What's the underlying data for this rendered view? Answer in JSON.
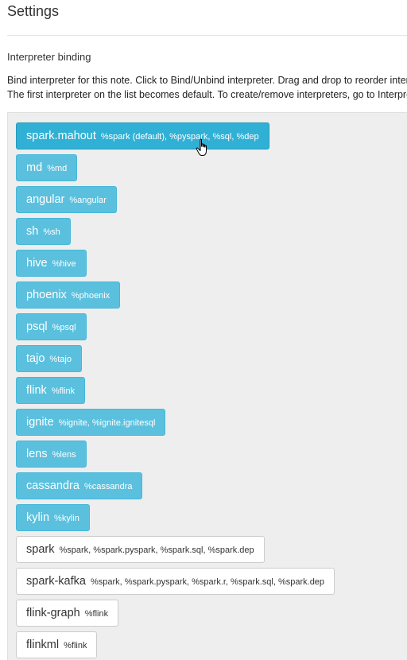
{
  "header": {
    "title": "Settings"
  },
  "interpreter_binding": {
    "heading": "Interpreter binding",
    "description_line1": "Bind interpreter for this note. Click to Bind/Unbind interpreter. Drag and drop to reorder interpreters.",
    "description_line2": "The first interpreter on the list becomes default. To create/remove interpreters, go to Interpreter menu.",
    "interpreters": [
      {
        "name": "spark.mahout",
        "aliases": "%spark (default), %pyspark, %sql, %dep",
        "selected": true,
        "hover": true
      },
      {
        "name": "md",
        "aliases": "%md",
        "selected": true
      },
      {
        "name": "angular",
        "aliases": "%angular",
        "selected": true
      },
      {
        "name": "sh",
        "aliases": "%sh",
        "selected": true
      },
      {
        "name": "hive",
        "aliases": "%hive",
        "selected": true
      },
      {
        "name": "phoenix",
        "aliases": "%phoenix",
        "selected": true
      },
      {
        "name": "psql",
        "aliases": "%psql",
        "selected": true
      },
      {
        "name": "tajo",
        "aliases": "%tajo",
        "selected": true
      },
      {
        "name": "flink",
        "aliases": "%flink",
        "selected": true
      },
      {
        "name": "ignite",
        "aliases": "%ignite, %ignite.ignitesql",
        "selected": true
      },
      {
        "name": "lens",
        "aliases": "%lens",
        "selected": true
      },
      {
        "name": "cassandra",
        "aliases": "%cassandra",
        "selected": true
      },
      {
        "name": "kylin",
        "aliases": "%kylin",
        "selected": true
      },
      {
        "name": "spark",
        "aliases": "%spark, %spark.pyspark, %spark.sql, %spark.dep",
        "selected": false
      },
      {
        "name": "spark-kafka",
        "aliases": "%spark, %spark.pyspark, %spark.r, %spark.sql, %spark.dep",
        "selected": false
      },
      {
        "name": "flink-graph",
        "aliases": "%flink",
        "selected": false
      },
      {
        "name": "flinkml",
        "aliases": "%flink",
        "selected": false
      }
    ]
  },
  "colors": {
    "selected_bg": "#5bc0de",
    "selected_hover_bg": "#31b0d5",
    "unselected_bg": "#ffffff",
    "panel_bg": "#eeeeee"
  },
  "cursor": {
    "icon": "hand-pointer-icon"
  }
}
